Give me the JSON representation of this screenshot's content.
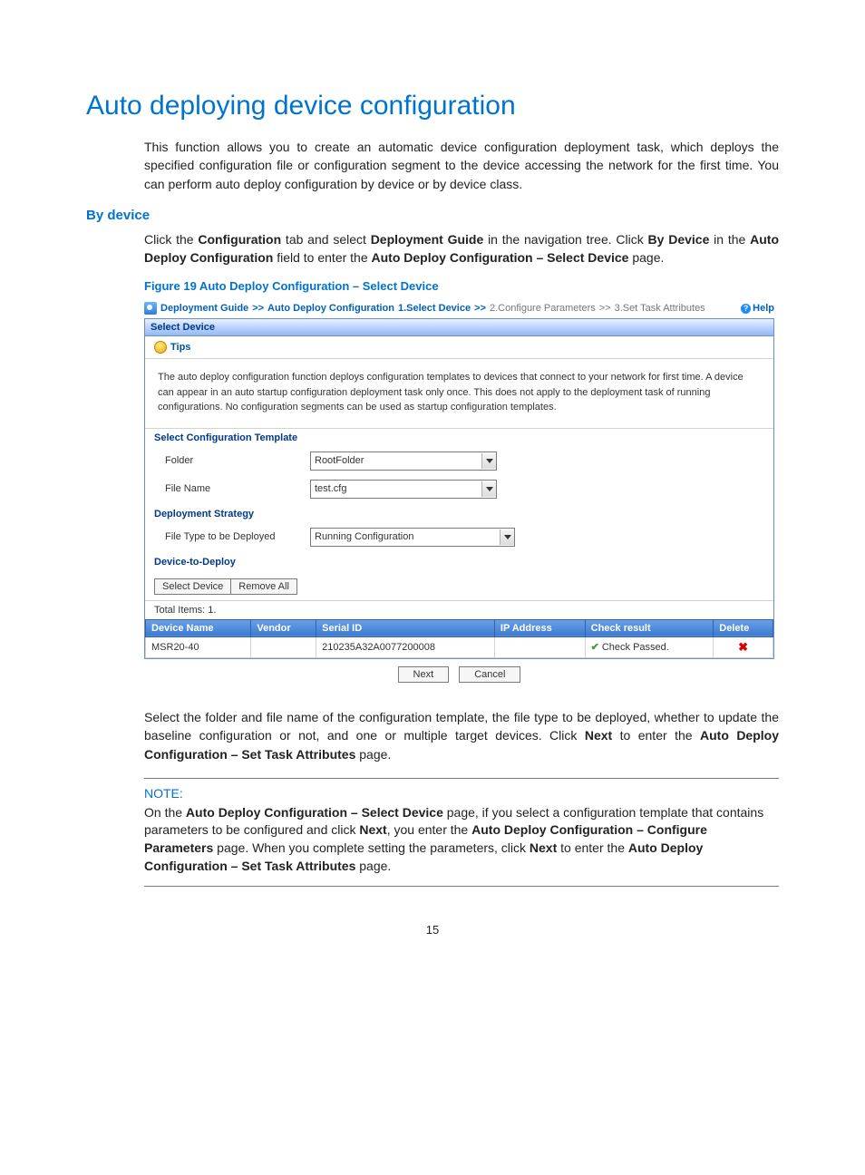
{
  "title": "Auto deploying device configuration",
  "intro": "This function allows you to create an automatic device configuration deployment task, which deploys the specified configuration file or configuration segment to the device accessing the network for the first time. You can perform auto deploy configuration by device or by device class.",
  "section_heading": "By device",
  "p1_pre": "Click the ",
  "p1_b1": "Configuration",
  "p1_mid1": " tab and select ",
  "p1_b2": "Deployment Guide",
  "p1_mid2": " in the navigation tree. Click ",
  "p1_b3": "By Device",
  "p1_mid3": " in the ",
  "p1_b4": "Auto Deploy Configuration",
  "p1_mid4": " field to enter the ",
  "p1_b5": "Auto Deploy Configuration – Select Device",
  "p1_end": " page.",
  "figure_caption": "Figure 19 Auto Deploy Configuration – Select Device",
  "breadcrumb": {
    "a": "Deployment Guide",
    "b": "Auto Deploy Configuration",
    "step1": "1.Select Device",
    "step2": "2.Configure Parameters",
    "step3": "3.Set Task Attributes",
    "help": "Help"
  },
  "panel": {
    "title": "Select Device",
    "tips_label": "Tips",
    "tips_text": "The auto deploy configuration function deploys configuration templates to devices that connect to your network for first time. A device can appear in an auto startup configuration deployment task only once. This does not apply to the deployment task of running configurations. No configuration segments can be used as startup configuration templates.",
    "template_hd": "Select Configuration Template",
    "folder_label": "Folder",
    "folder_value": "RootFolder",
    "filename_label": "File Name",
    "filename_value": "test.cfg",
    "strategy_hd": "Deployment Strategy",
    "filetype_label": "File Type to be Deployed",
    "filetype_value": "Running Configuration",
    "device_hd": "Device-to-Deploy",
    "select_device_btn": "Select Device",
    "remove_all_btn": "Remove All",
    "total_items": "Total Items: 1.",
    "cols": {
      "device_name": "Device Name",
      "vendor": "Vendor",
      "serial_id": "Serial ID",
      "ip": "IP Address",
      "check": "Check result",
      "delete": "Delete"
    },
    "row": {
      "device_name": "MSR20-40",
      "vendor": "",
      "serial_id": "210235A32A0077200008",
      "ip": "",
      "check": "Check Passed."
    },
    "next_btn": "Next",
    "cancel_btn": "Cancel"
  },
  "p2_pre": "Select the folder and file name of the configuration template, the file type to be deployed, whether to update the baseline configuration or not, and one or multiple target devices. Click ",
  "p2_b1": "Next",
  "p2_mid1": " to enter the ",
  "p2_b2": "Auto Deploy Configuration – Set Task Attributes",
  "p2_end": " page.",
  "note": {
    "label": "NOTE:",
    "pre": "On the ",
    "b1": "Auto Deploy Configuration – Select Device",
    "mid1": " page, if you select a configuration template that contains parameters to be configured and click ",
    "b2": "Next",
    "mid2": ", you enter the ",
    "b3": "Auto Deploy Configuration – Configure Parameters",
    "mid3": " page. When you complete setting the parameters, click ",
    "b4": "Next",
    "mid4": " to enter the ",
    "b5": "Auto Deploy Configuration – Set Task Attributes",
    "end": " page."
  },
  "page_number": "15"
}
